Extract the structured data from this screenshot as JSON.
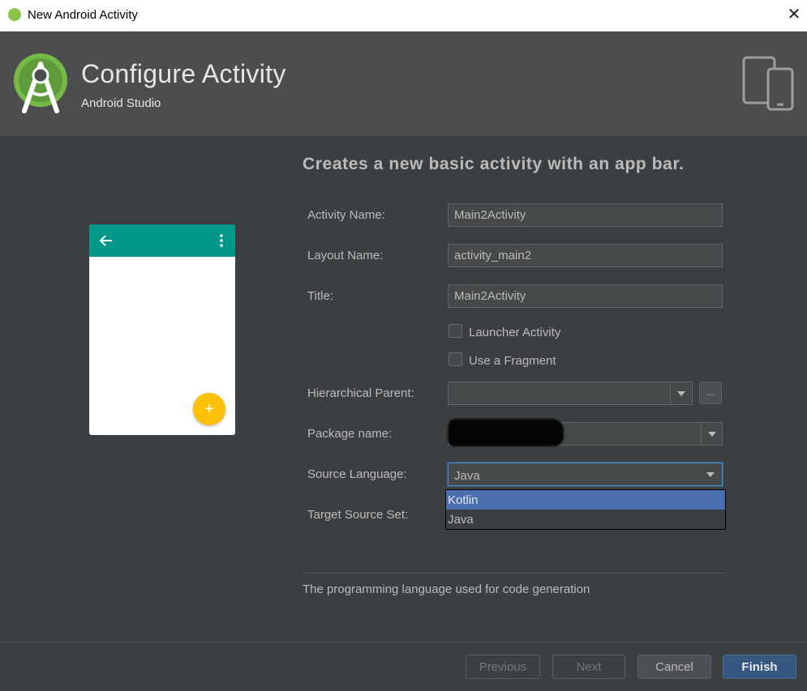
{
  "window": {
    "title": "New Android Activity",
    "close_glyph": "✕"
  },
  "header": {
    "title": "Configure Activity",
    "subtitle": "Android Studio",
    "logo_icon": "android-studio-logo-icon",
    "device_icon": "devices-icon"
  },
  "preview": {
    "appbar_color": "#009688",
    "fab_color": "#ffc107",
    "fab_glyph": "+"
  },
  "form": {
    "description": "Creates a new basic activity with an app bar.",
    "activity_name": {
      "label": "Activity Name:",
      "value": "Main2Activity"
    },
    "layout_name": {
      "label": "Layout Name:",
      "value": "activity_main2"
    },
    "title": {
      "label": "Title:",
      "value": "Main2Activity"
    },
    "launcher_activity": {
      "label": "Launcher Activity",
      "checked": false
    },
    "use_fragment": {
      "label": "Use a Fragment",
      "checked": false
    },
    "hierarchical_parent": {
      "label": "Hierarchical Parent:",
      "value": "",
      "browse_label": "..."
    },
    "package_name": {
      "label": "Package name:",
      "value": ""
    },
    "source_language": {
      "label": "Source Language:",
      "value": "Java",
      "options": [
        "Kotlin",
        "Java"
      ],
      "highlighted": "Kotlin"
    },
    "target_source_set": {
      "label": "Target Source Set:"
    },
    "help_text": "The programming language used for code generation"
  },
  "buttons": {
    "previous": "Previous",
    "next": "Next",
    "cancel": "Cancel",
    "finish": "Finish"
  },
  "colors": {
    "background": "#3c3f41",
    "header": "#4b4d4f",
    "selection": "#4b6eaf",
    "primary_button": "#365880"
  }
}
